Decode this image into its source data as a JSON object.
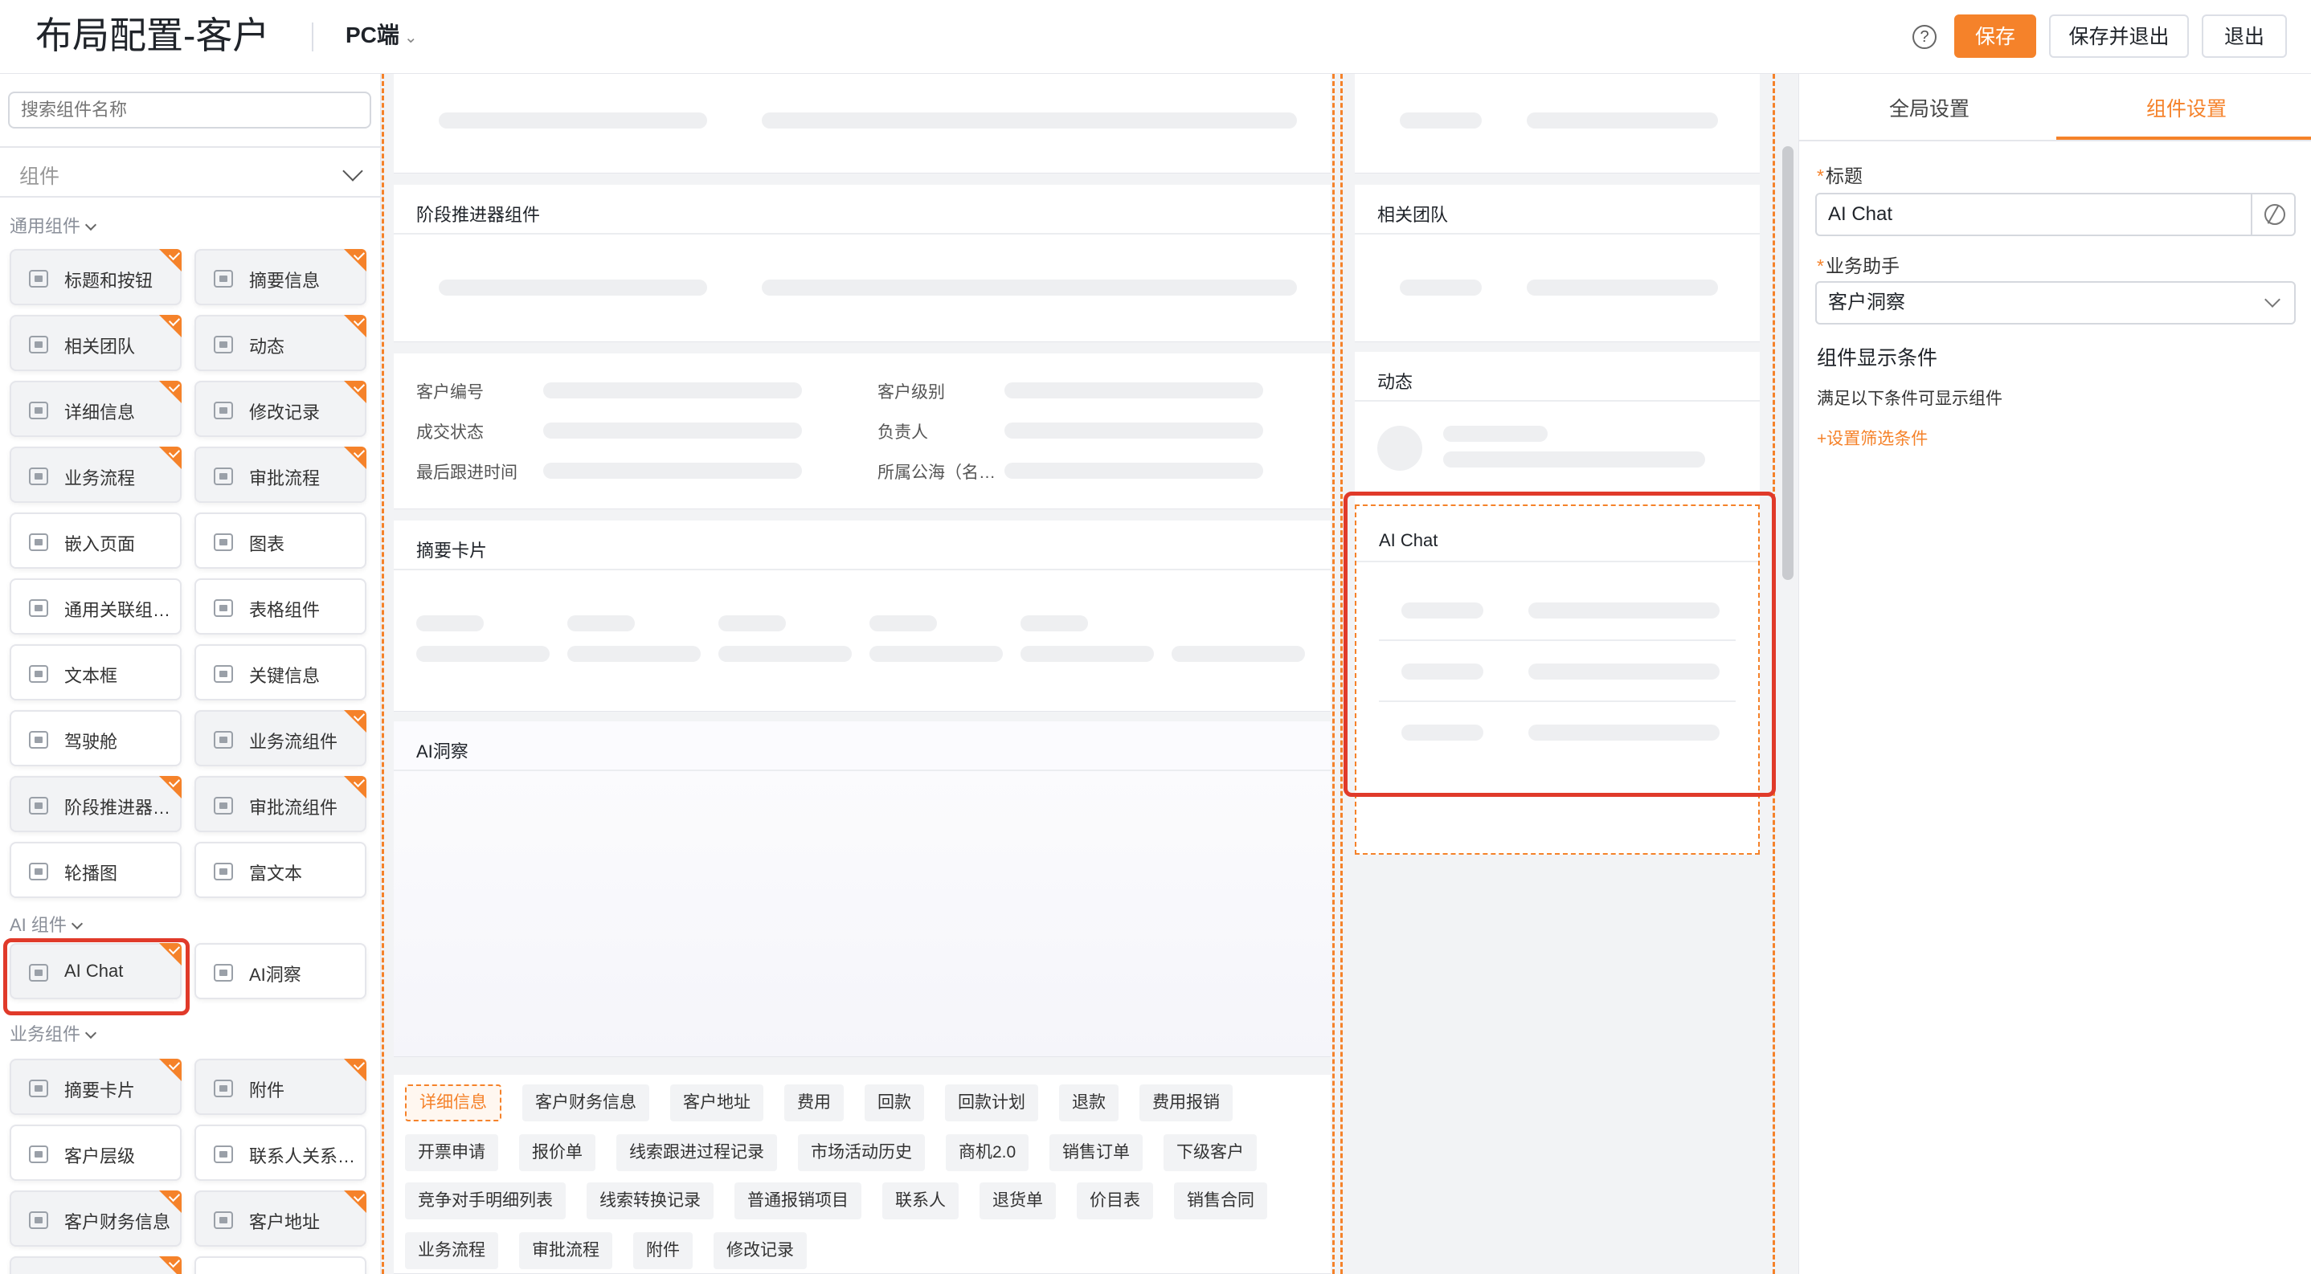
{
  "header": {
    "title": "布局配置-客户",
    "platform": "PC端",
    "help_icon": "?",
    "save": "保存",
    "save_exit": "保存并退出",
    "exit": "退出"
  },
  "left": {
    "search_placeholder": "搜索组件名称",
    "select_label": "组件",
    "groups": {
      "general": "通用组件",
      "ai": "AI 组件",
      "business": "业务组件"
    },
    "general_items": [
      {
        "label": "标题和按钮",
        "used": true
      },
      {
        "label": "摘要信息",
        "used": true
      },
      {
        "label": "相关团队",
        "used": true
      },
      {
        "label": "动态",
        "used": true
      },
      {
        "label": "详细信息",
        "used": true
      },
      {
        "label": "修改记录",
        "used": true
      },
      {
        "label": "业务流程",
        "used": true
      },
      {
        "label": "审批流程",
        "used": true
      },
      {
        "label": "嵌入页面",
        "used": false
      },
      {
        "label": "图表",
        "used": false
      },
      {
        "label": "通用关联组…",
        "used": false
      },
      {
        "label": "表格组件",
        "used": false
      },
      {
        "label": "文本框",
        "used": false
      },
      {
        "label": "关键信息",
        "used": false
      },
      {
        "label": "驾驶舱",
        "used": false
      },
      {
        "label": "业务流组件",
        "used": true
      },
      {
        "label": "阶段推进器…",
        "used": true
      },
      {
        "label": "审批流组件",
        "used": true
      },
      {
        "label": "轮播图",
        "used": false
      },
      {
        "label": "富文本",
        "used": false
      }
    ],
    "ai_items": [
      {
        "label": "AI Chat",
        "used": true
      },
      {
        "label": "AI洞察",
        "used": false
      }
    ],
    "business_items": [
      {
        "label": "摘要卡片",
        "used": true
      },
      {
        "label": "附件",
        "used": true
      },
      {
        "label": "客户层级",
        "used": false
      },
      {
        "label": "联系人关系…",
        "used": false
      },
      {
        "label": "客户财务信息",
        "used": true
      },
      {
        "label": "客户地址",
        "used": true
      }
    ]
  },
  "center": {
    "stage_title": "阶段推进器组件",
    "detail_fields": [
      "客户编号",
      "客户级别",
      "成交状态",
      "负责人",
      "最后跟进时间",
      "所属公海（名…"
    ],
    "summary_title": "摘要卡片",
    "ai_insight_title": "AI洞察",
    "tags": [
      [
        "详细信息",
        "客户财务信息",
        "客户地址",
        "费用",
        "回款",
        "回款计划",
        "退款",
        "费用报销"
      ],
      [
        "开票申请",
        "报价单",
        "线索跟进过程记录",
        "市场活动历史",
        "商机2.0",
        "销售订单",
        "下级客户"
      ],
      [
        "竞争对手明细列表",
        "线索转换记录",
        "普通报销项目",
        "联系人",
        "退货单",
        "价目表",
        "销售合同"
      ],
      [
        "业务流程",
        "审批流程",
        "附件",
        "修改记录"
      ]
    ],
    "side_team_title": "相关团队",
    "side_feed_title": "动态",
    "side_aichat_title": "AI Chat"
  },
  "right": {
    "tab_global": "全局设置",
    "tab_component": "组件设置",
    "title_label": "标题",
    "title_value": "AI Chat",
    "assistant_label": "业务助手",
    "assistant_value": "客户洞察",
    "cond_heading": "组件显示条件",
    "cond_text": "满足以下条件可显示组件",
    "cond_link": "+设置筛选条件"
  },
  "colors": {
    "accent": "#f5822a",
    "highlight": "#e03a2a"
  }
}
